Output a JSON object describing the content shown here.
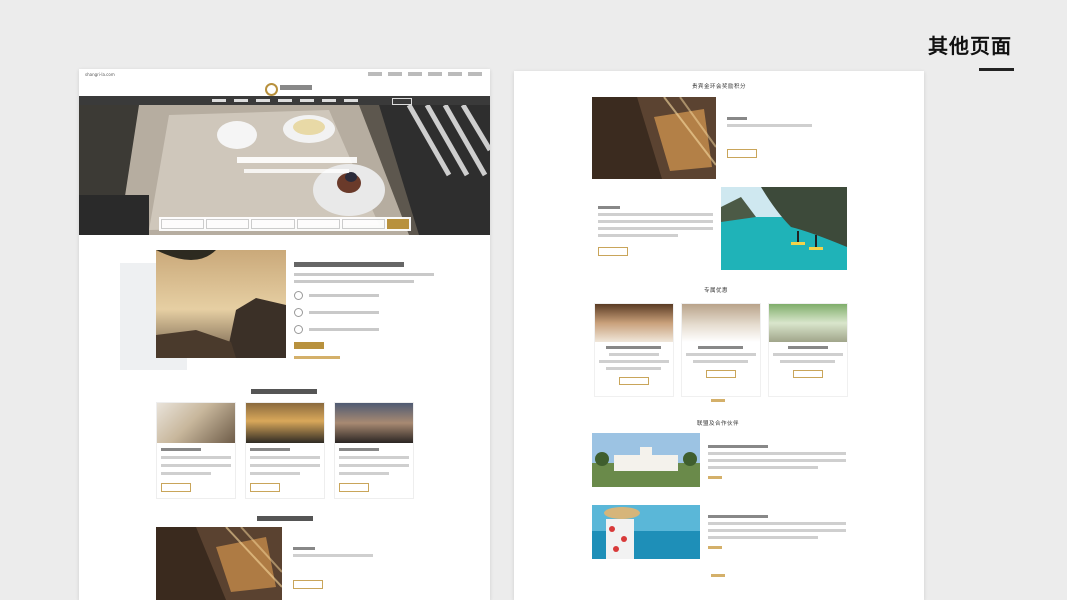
{
  "page": {
    "heading": "其他页面",
    "accent_color": "#b8913d"
  },
  "left_mockup": {
    "domain": "shangri-la.com",
    "nav_item_count": 7,
    "icons": [
      "logo-icon",
      "search-icon"
    ]
  },
  "right_mockup": {
    "section_points": {
      "title": "贵宾金环会奖励积分"
    },
    "section_offers": {
      "title": "专属优惠"
    },
    "section_partners": {
      "title": "联盟及合作伙伴"
    }
  }
}
